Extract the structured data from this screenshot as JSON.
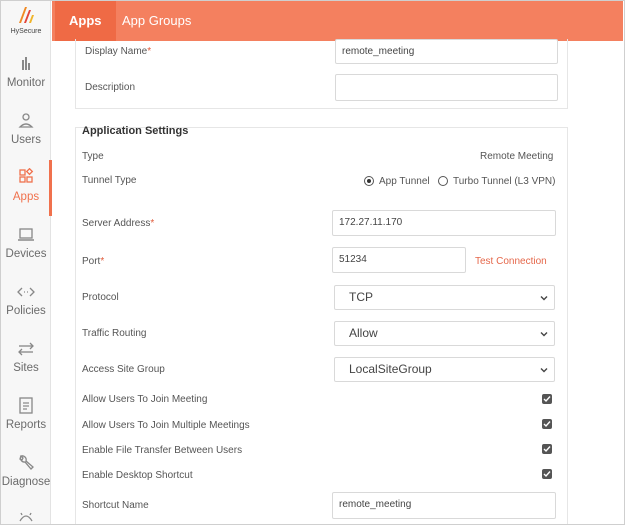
{
  "brand": {
    "name": "HySecure",
    "accent": "#f0714d"
  },
  "sidebar": {
    "items": [
      {
        "label": "Monitor",
        "icon": "bar-chart-icon"
      },
      {
        "label": "Users",
        "icon": "user-icon"
      },
      {
        "label": "Apps",
        "icon": "apps-grid-icon",
        "active": true
      },
      {
        "label": "Devices",
        "icon": "laptop-icon"
      },
      {
        "label": "Policies",
        "icon": "code-arrows-icon"
      },
      {
        "label": "Sites",
        "icon": "swap-arrows-icon"
      },
      {
        "label": "Reports",
        "icon": "report-icon"
      },
      {
        "label": "Diagnose",
        "icon": "wrench-icon"
      }
    ]
  },
  "tabs": [
    {
      "label": "Apps",
      "active": true
    },
    {
      "label": "App Groups",
      "active": false
    }
  ],
  "form": {
    "display_name": {
      "label": "Display Name",
      "value": "remote_meeting"
    },
    "description": {
      "label": "Description",
      "value": ""
    },
    "section_title": "Application Settings",
    "type": {
      "label": "Type",
      "value": "Remote Meeting"
    },
    "tunnel_type": {
      "label": "Tunnel Type",
      "option1": "App Tunnel",
      "option2": "Turbo Tunnel (L3 VPN)"
    },
    "server_address": {
      "label": "Server Address",
      "value": "172.27.11.170"
    },
    "port": {
      "label": "Port",
      "value": "51234",
      "test_label": "Test Connection"
    },
    "protocol": {
      "label": "Protocol",
      "value": "TCP"
    },
    "traffic_routing": {
      "label": "Traffic Routing",
      "value": "Allow"
    },
    "access_site_group": {
      "label": "Access Site Group",
      "value": "LocalSiteGroup"
    },
    "allow_join": {
      "label": "Allow Users To Join Meeting",
      "checked": true
    },
    "allow_multiple": {
      "label": "Allow Users To Join Multiple Meetings",
      "checked": true
    },
    "file_transfer": {
      "label": "Enable File Transfer Between Users",
      "checked": true
    },
    "desktop_shortcut": {
      "label": "Enable Desktop Shortcut",
      "checked": true
    },
    "shortcut_name": {
      "label": "Shortcut Name",
      "value": "remote_meeting"
    }
  }
}
